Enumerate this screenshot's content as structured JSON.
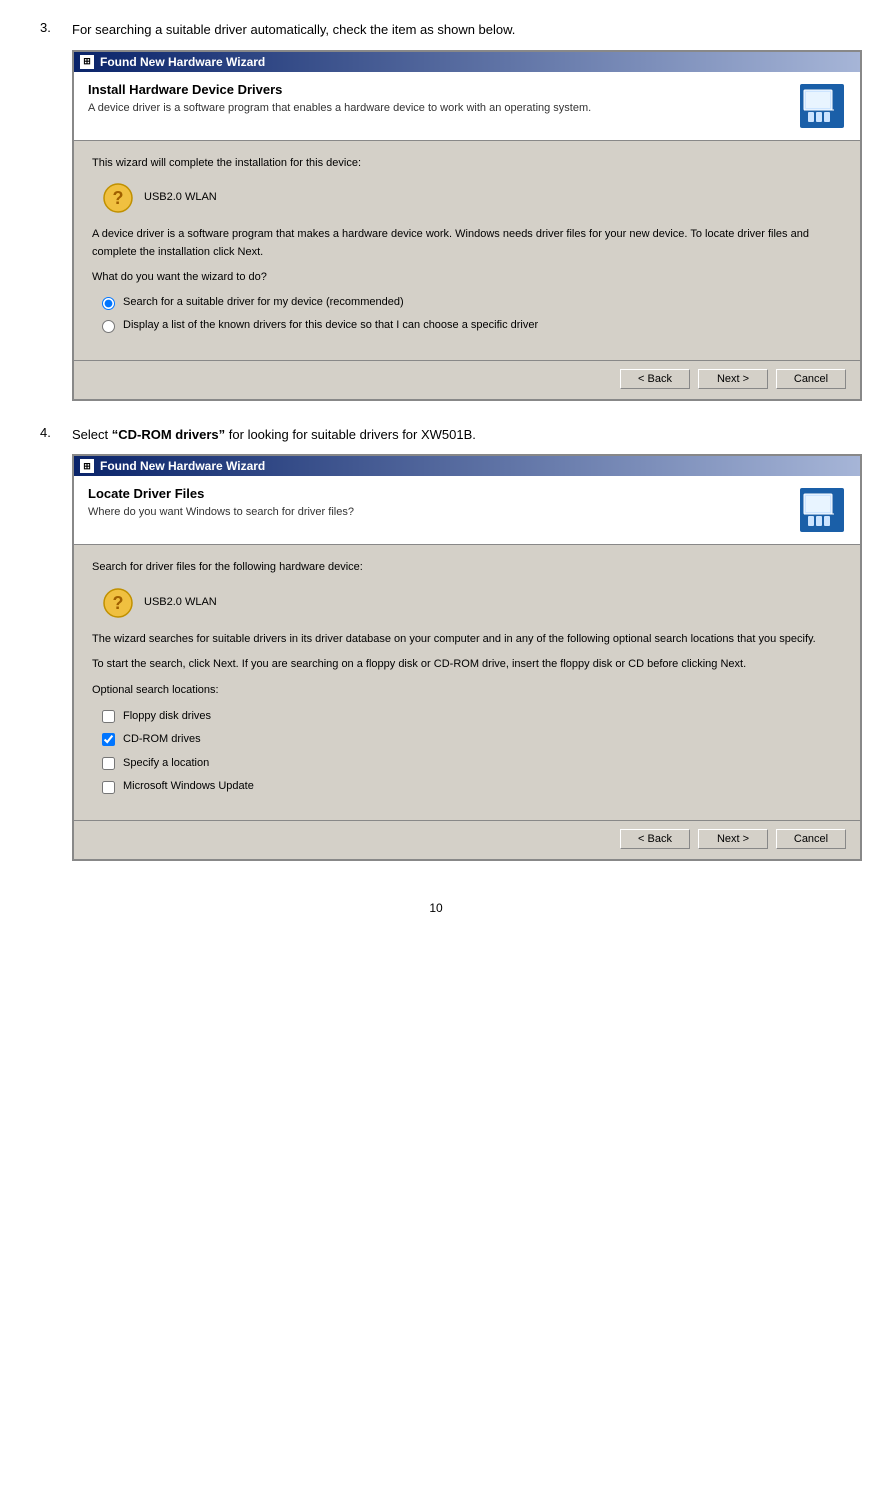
{
  "page": {
    "number": "10"
  },
  "step3": {
    "number": "3.",
    "description": "For searching a suitable driver automatically, check the item as shown below."
  },
  "step4": {
    "number": "4.",
    "description_prefix": "Select ",
    "description_bold": "“CD-ROM drivers”",
    "description_suffix": " for looking for suitable drivers for XW501B."
  },
  "dialog1": {
    "titlebar": "Found New Hardware Wizard",
    "header_title": "Install Hardware Device Drivers",
    "header_desc": "A device driver is a software program that enables a hardware device to work with an operating system.",
    "body_text1": "This wizard will complete the installation for this device:",
    "device_name": "USB2.0 WLAN",
    "body_text2": "A device driver is a software program that makes a hardware device work. Windows needs driver files for your new device. To locate driver files and complete the installation click Next.",
    "body_text3": "What do you want the wizard to do?",
    "radio1_label": "Search for a suitable driver for my device (recommended)",
    "radio2_label": "Display a list of the known drivers for this device so that I can choose a specific driver",
    "btn_back": "< Back",
    "btn_next": "Next >",
    "btn_cancel": "Cancel"
  },
  "dialog2": {
    "titlebar": "Found New Hardware Wizard",
    "header_title": "Locate Driver Files",
    "header_desc": "Where do you want Windows to search for driver files?",
    "body_text1": "Search for driver files for the following hardware device:",
    "device_name": "USB2.0 WLAN",
    "body_text2": "The wizard searches for suitable drivers in its driver database on your computer and in any of the following optional search locations that you specify.",
    "body_text3": "To start the search, click Next. If you are searching on a floppy disk or CD-ROM drive, insert the floppy disk or CD before clicking Next.",
    "optional_label": "Optional search locations:",
    "checkbox1_label": "Floppy disk drives",
    "checkbox1_checked": false,
    "checkbox2_label": "CD-ROM drives",
    "checkbox2_checked": true,
    "checkbox3_label": "Specify a location",
    "checkbox3_checked": false,
    "checkbox4_label": "Microsoft Windows Update",
    "checkbox4_checked": false,
    "btn_back": "< Back",
    "btn_next": "Next >",
    "btn_cancel": "Cancel"
  }
}
